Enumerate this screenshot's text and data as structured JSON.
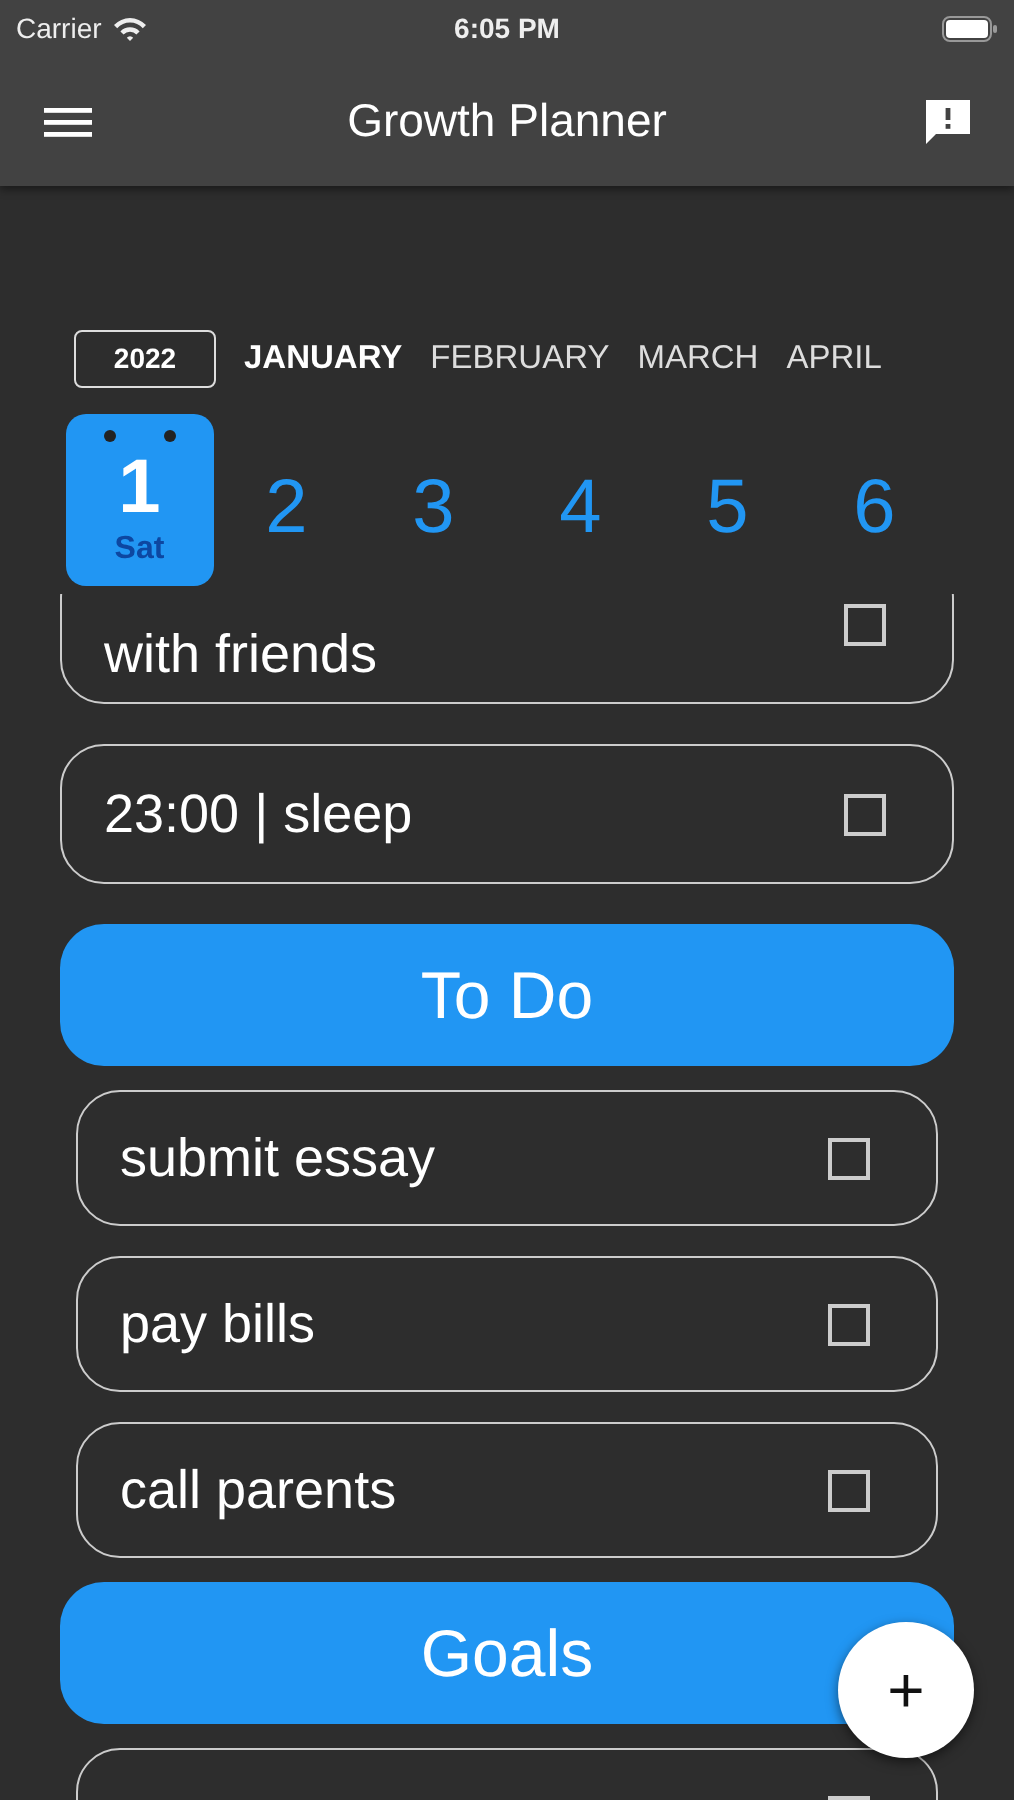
{
  "status_bar": {
    "carrier": "Carrier",
    "time": "6:05 PM"
  },
  "app_bar": {
    "title": "Growth Planner"
  },
  "year": "2022",
  "months": [
    {
      "label": "JANUARY",
      "selected": true
    },
    {
      "label": "FEBRUARY",
      "selected": false
    },
    {
      "label": "MARCH",
      "selected": false
    },
    {
      "label": "APRIL",
      "selected": false
    }
  ],
  "days": [
    {
      "number": "1",
      "weekday": "Sat",
      "selected": true
    },
    {
      "number": "2",
      "selected": false
    },
    {
      "number": "3",
      "selected": false
    },
    {
      "number": "4",
      "selected": false
    },
    {
      "number": "5",
      "selected": false
    },
    {
      "number": "6",
      "selected": false
    }
  ],
  "list": [
    {
      "kind": "event",
      "text": "with friends",
      "checked": false
    },
    {
      "kind": "event",
      "text": "23:00 | sleep",
      "checked": false
    },
    {
      "kind": "header",
      "title": "To Do"
    },
    {
      "kind": "task",
      "text": "submit essay",
      "checked": false
    },
    {
      "kind": "task",
      "text": "pay bills",
      "checked": false
    },
    {
      "kind": "task",
      "text": "call parents",
      "checked": false
    },
    {
      "kind": "header",
      "title": "Goals"
    },
    {
      "kind": "task",
      "checked": false
    }
  ],
  "fab": {
    "label": "+"
  }
}
